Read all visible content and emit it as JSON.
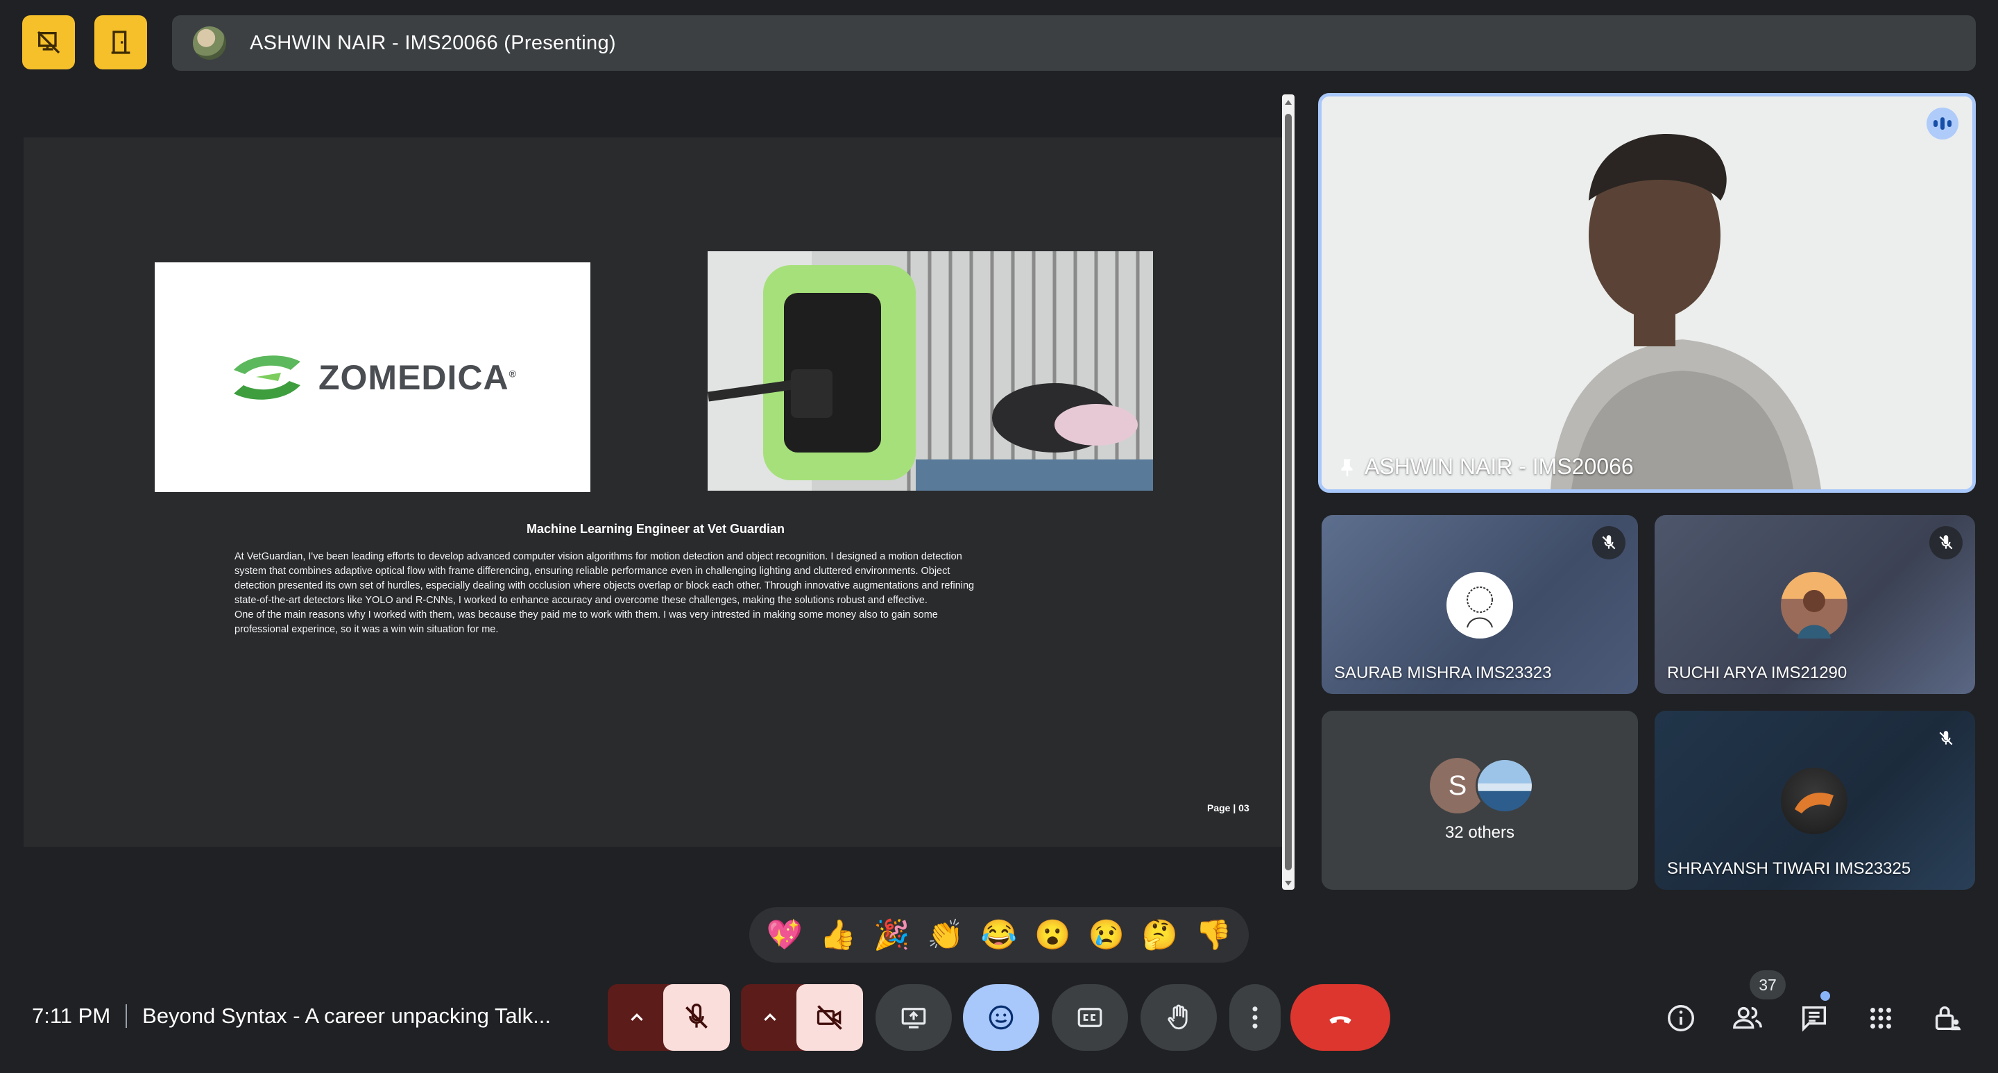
{
  "presenter_bar": {
    "name": "ASHWIN NAIR - IMS20066 (Presenting)"
  },
  "slide": {
    "logo_text": "ZOMEDICA",
    "logo_mark": "®",
    "title": "Machine Learning Engineer at Vet Guardian",
    "body_lines": [
      "At VetGuardian, I've been leading efforts to develop advanced computer vision algorithms for motion detection and object recognition. I designed a motion detection",
      "system that combines adaptive optical flow with frame differencing, ensuring reliable performance even in challenging lighting and cluttered environments. Object",
      "detection presented its own set of hurdles, especially dealing with occlusion where objects overlap or block each other. Through innovative augmentations and refining",
      "state-of-the-art detectors like YOLO and R-CNNs, I worked to enhance accuracy and overcome these challenges, making the solutions robust and effective.",
      "One of the main reasons why I worked with them, was because they paid me to work with them. I was very intrested in making some money also to gain some",
      "professional experince, so it was a win win situation for me."
    ],
    "page_label": "Page | 03"
  },
  "participants": {
    "main": {
      "name": "ASHWIN NAIR - IMS20066"
    },
    "saurab": {
      "name": "SAURAB MISHRA IMS23323"
    },
    "ruchi": {
      "name": "RUCHI ARYA IMS21290"
    },
    "others": {
      "initial": "S",
      "label": "32 others"
    },
    "shrayansh": {
      "name": "SHRAYANSH TIWARI IMS23325"
    }
  },
  "reactions": [
    "💖",
    "👍",
    "🎉",
    "👏",
    "😂",
    "😮",
    "😢",
    "🤔",
    "👎"
  ],
  "bottom_bar": {
    "time": "7:11 PM",
    "meeting_title": "Beyond Syntax - A career unpacking Talk...",
    "people_count": "37"
  },
  "colors": {
    "accent_yellow": "#f6c02b",
    "active_blue": "#a8c7fa",
    "hangup_red": "#dc362e",
    "background": "#202124"
  }
}
